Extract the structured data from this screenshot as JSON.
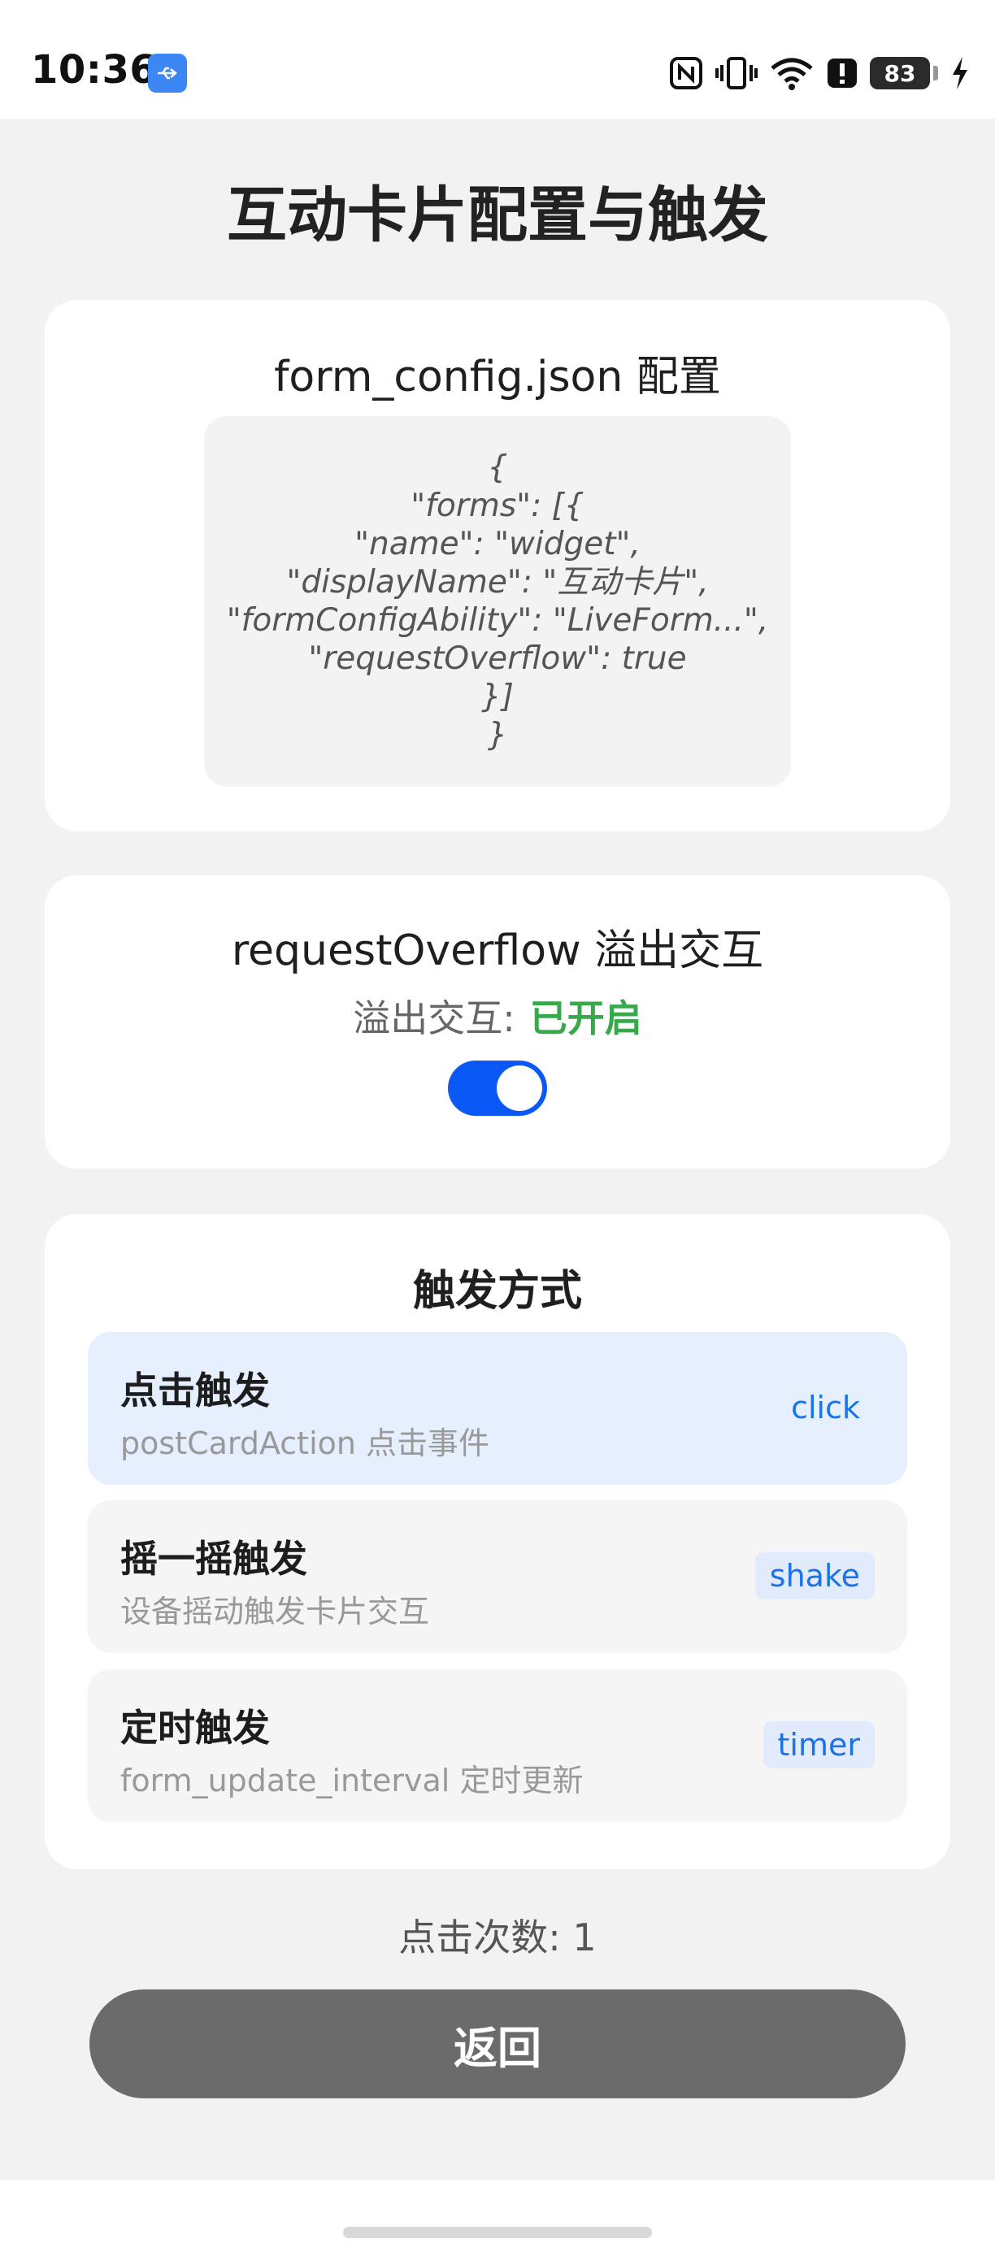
{
  "status_bar": {
    "time": "10:36",
    "usb_icon": "usb-icon",
    "icons": [
      "nfc-icon",
      "vibrate-icon",
      "wifi-icon",
      "alert-icon"
    ],
    "battery": "83",
    "charging_icon": "lightning-icon"
  },
  "page": {
    "title": "互动卡片配置与触发"
  },
  "config_card": {
    "title": "form_config.json 配置",
    "code_lines": [
      "{",
      "\"forms\": [{",
      "\"name\": \"widget\",",
      "\"displayName\": \"互动卡片\",",
      "\"formConfigAbility\": \"LiveForm...\",",
      "\"requestOverflow\": true",
      "}]",
      "}"
    ]
  },
  "overflow_card": {
    "title": "requestOverflow 溢出交互",
    "status_label": "溢出交互:",
    "status_value": "已开启",
    "toggle_on": true
  },
  "trigger_card": {
    "title": "触发方式",
    "items": [
      {
        "title": "点击触发",
        "desc": "postCardAction 点击事件",
        "tag": "click",
        "active": true
      },
      {
        "title": "摇一摇触发",
        "desc": "设备摇动触发卡片交互",
        "tag": "shake",
        "active": false
      },
      {
        "title": "定时触发",
        "desc": "form_update_interval 定时更新",
        "tag": "timer",
        "active": false
      }
    ]
  },
  "footer": {
    "click_count": "点击次数: 1",
    "back_label": "返回"
  },
  "colors": {
    "accent": "#0a59f7",
    "status_on": "#38a84a",
    "tag_text": "#1a73e8",
    "back_button": "#6b6b6b"
  }
}
